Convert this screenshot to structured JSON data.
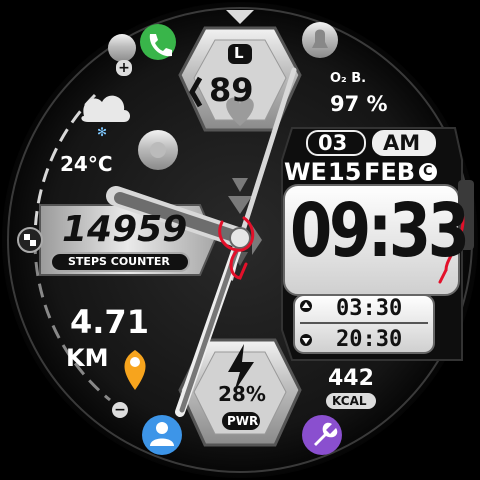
{
  "colors": {
    "accent_red": "#e3102a",
    "phone": "#39b54a",
    "location": "#f7a41d",
    "user": "#3d95e8",
    "tool": "#8a4fcf"
  },
  "heart": {
    "badge": "L",
    "value": "89"
  },
  "oxygen": {
    "label": "O₂ B.",
    "value": "97 %"
  },
  "weather": {
    "temperature": "24°C",
    "icon": "cloud-snow-icon"
  },
  "steps": {
    "value": "14959",
    "label": "STEPS COUNTER"
  },
  "distance": {
    "value": "4.71",
    "unit": "KM"
  },
  "battery": {
    "value": "28%",
    "label": "PWR",
    "icon": "lightning-icon"
  },
  "calories": {
    "value": "442",
    "label": "KCAL"
  },
  "date": {
    "day_num": "03",
    "ampm": "AM",
    "weekday": "WE",
    "day": "15",
    "month": "FEB",
    "c_badge": "C"
  },
  "time": {
    "main": "09:33"
  },
  "alarms": [
    {
      "time": "03:30",
      "icon": "up-arrow-icon"
    },
    {
      "time": "20:30",
      "icon": "down-arrow-icon"
    }
  ],
  "controls": {
    "plus": "+",
    "minus": "−"
  }
}
